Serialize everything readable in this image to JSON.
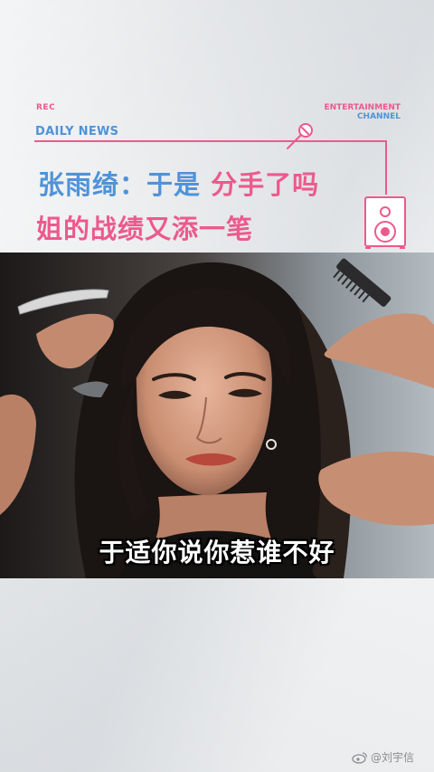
{
  "header": {
    "rec_label": "REC",
    "entertainment_label": "ENTERTAINMENT",
    "channel_label": "CHANNEL",
    "daily_news_label": "DAILY NEWS"
  },
  "headline": {
    "line1_blue": "张雨绮：于是",
    "line1_pink": "分手了吗",
    "line2": "姐的战绩又添一笔"
  },
  "video": {
    "subtitle": "于适你说你惹谁不好"
  },
  "watermark": {
    "text": "@刘宇信"
  },
  "colors": {
    "accent_pink": "#ec5a8c",
    "accent_blue": "#4f93d8",
    "background": "#eceeef"
  },
  "icons": [
    "microphone-icon",
    "speaker-icon",
    "weibo-icon"
  ]
}
